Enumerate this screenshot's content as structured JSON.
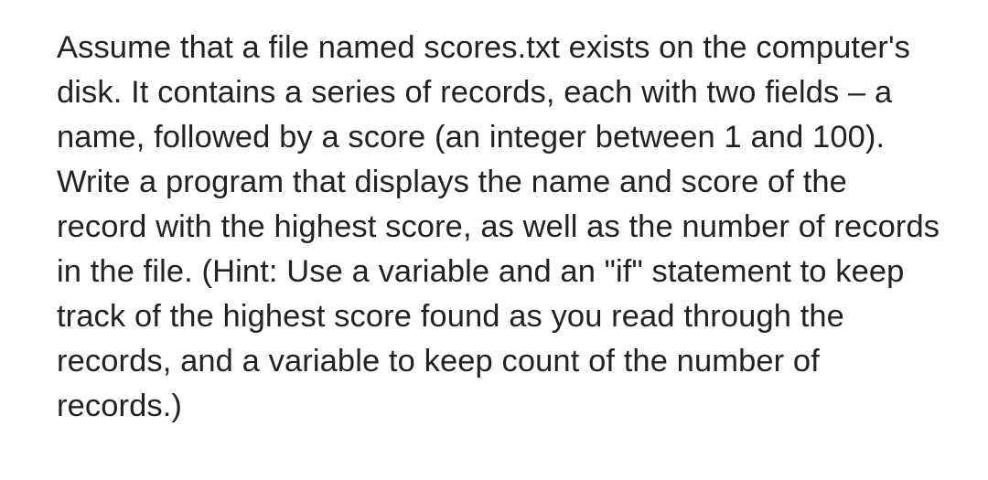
{
  "text": {
    "p1": "Assume that a file named scores.txt exists on the computer's disk. It contains a series of records, each with two fields – a name, followed by a score (an integer between 1 and 100).",
    "p2": "Write a program that displays the name and score of the record with the highest score, as well as the number of records in the file. (Hint: Use a variable and an \"if\" statement to keep track of the highest score found as you read through the records, and a variable to keep count of the number of records.)"
  }
}
